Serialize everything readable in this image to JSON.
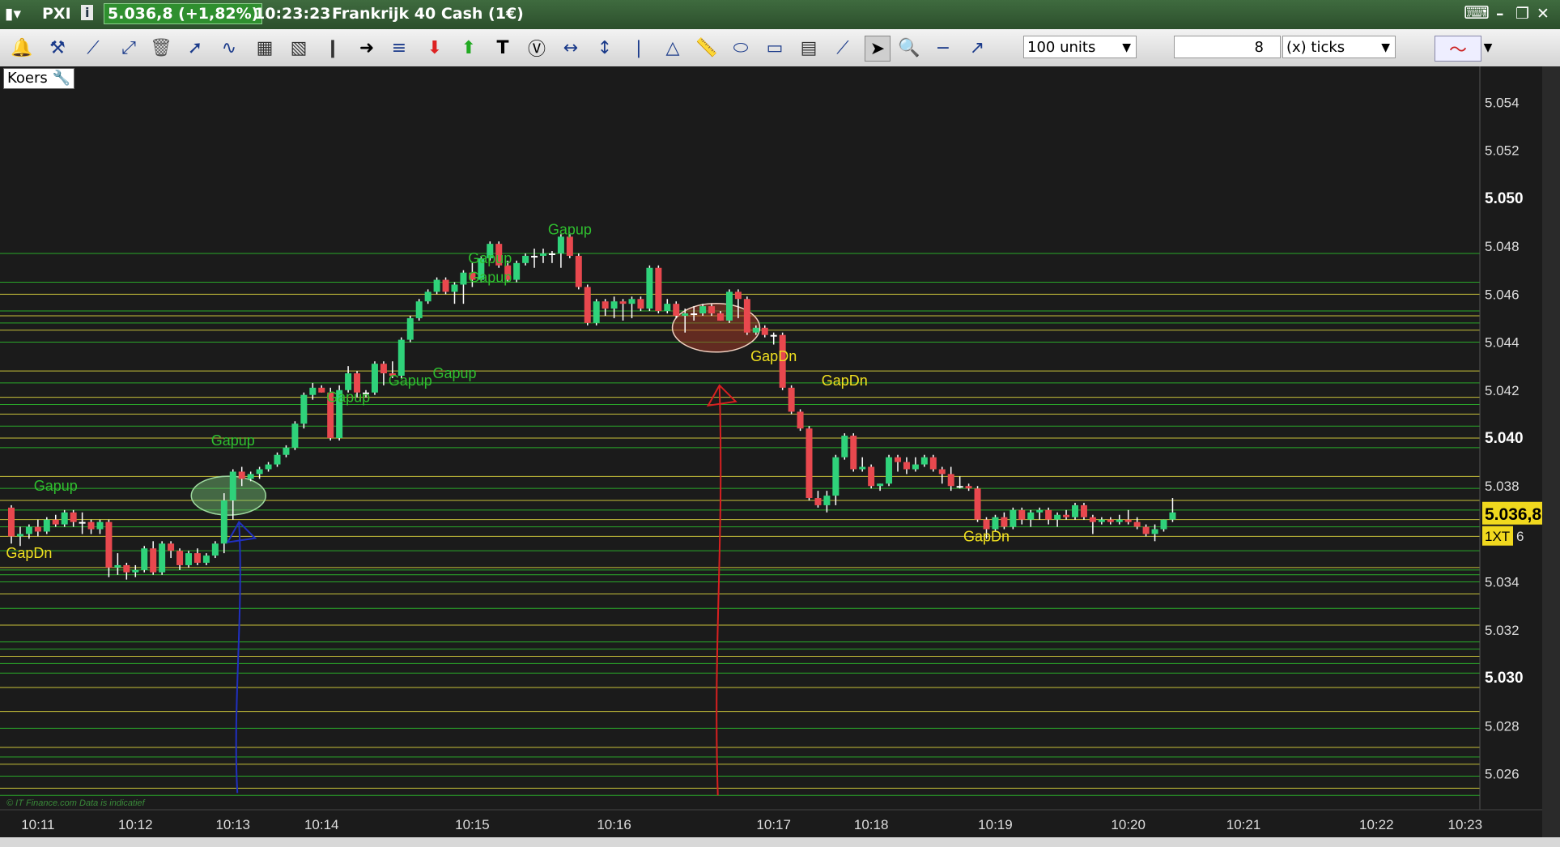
{
  "title": {
    "symbol": "PXI",
    "price_badge": "5.036,8 (+1,82%)",
    "time": "10:23:23",
    "instrument": "Frankrijk 40 Cash (1€)"
  },
  "toolbar": {
    "units": "100 units",
    "ticks_value": "8",
    "ticks_unit": "(x) ticks"
  },
  "panel_label": "Koers",
  "copyright": "© IT Finance.com  Data is indicatief",
  "colors": {
    "up": "#2fd27a",
    "down": "#e8484e",
    "bg": "#1b1b1b",
    "green_line": "#2aa82a",
    "yellow_line": "#c8c23a"
  },
  "chart_data": {
    "type": "candlestick",
    "y_range": [
      5.0245,
      5.0555
    ],
    "y_ticks": [
      5.054,
      5.052,
      5.05,
      5.048,
      5.046,
      5.044,
      5.042,
      5.04,
      5.038,
      5.036,
      5.034,
      5.032,
      5.03,
      5.028,
      5.026
    ],
    "y_tick_labels": [
      "5.054",
      "5.052",
      "5.050",
      "5.048",
      "5.046",
      "5.044",
      "5.042",
      "5.040",
      "5.038",
      "",
      "5.034",
      "5.032",
      "5.030",
      "5.028",
      "5.026"
    ],
    "y_bold": [
      "5.050",
      "5.040",
      "5.030"
    ],
    "x_ticks": [
      "10:11",
      "10:12",
      "10:13",
      "10:14",
      "10:15",
      "10:16",
      "10:17",
      "10:18",
      "10:19",
      "10:20",
      "10:21",
      "10:22",
      "10:23"
    ],
    "x_tick_index": [
      3,
      14,
      25,
      35,
      52,
      68,
      86,
      97,
      111,
      126,
      139,
      154,
      164
    ],
    "last_price": "5.036,8",
    "last_price_value": 5.0368,
    "cursor_tag": "1XT",
    "cursor_tag_suffix": "6",
    "candles": [
      [
        5.0371,
        5.0372,
        5.0356,
        5.0359
      ],
      [
        5.0359,
        5.0363,
        5.0355,
        5.036
      ],
      [
        5.036,
        5.0364,
        5.0358,
        5.0363
      ],
      [
        5.0363,
        5.0366,
        5.0359,
        5.0361
      ],
      [
        5.0361,
        5.0367,
        5.036,
        5.0366
      ],
      [
        5.0366,
        5.0368,
        5.0363,
        5.0364
      ],
      [
        5.0364,
        5.037,
        5.0363,
        5.0369
      ],
      [
        5.0369,
        5.037,
        5.0363,
        5.0365
      ],
      [
        5.0365,
        5.0369,
        5.036,
        5.0365
      ],
      [
        5.0365,
        5.0366,
        5.036,
        5.0362
      ],
      [
        5.0362,
        5.0366,
        5.036,
        5.0365
      ],
      [
        5.0365,
        5.0366,
        5.0342,
        5.0346
      ],
      [
        5.0346,
        5.0352,
        5.0343,
        5.0347
      ],
      [
        5.0347,
        5.0348,
        5.0341,
        5.0344
      ],
      [
        5.0344,
        5.0347,
        5.0342,
        5.0345
      ],
      [
        5.0345,
        5.0355,
        5.0344,
        5.0354
      ],
      [
        5.0354,
        5.0357,
        5.0343,
        5.0344
      ],
      [
        5.0344,
        5.0357,
        5.0343,
        5.0356
      ],
      [
        5.0356,
        5.0357,
        5.035,
        5.0353
      ],
      [
        5.0353,
        5.0354,
        5.0345,
        5.0347
      ],
      [
        5.0347,
        5.0353,
        5.0346,
        5.0352
      ],
      [
        5.0352,
        5.0354,
        5.0347,
        5.0348
      ],
      [
        5.0348,
        5.0352,
        5.0347,
        5.0351
      ],
      [
        5.0351,
        5.0357,
        5.035,
        5.0356
      ],
      [
        5.0356,
        5.0377,
        5.0352,
        5.0374
      ],
      [
        5.0374,
        5.0387,
        5.0366,
        5.0386
      ],
      [
        5.0386,
        5.0388,
        5.038,
        5.0383
      ],
      [
        5.0383,
        5.0386,
        5.0382,
        5.0385
      ],
      [
        5.0385,
        5.0388,
        5.0383,
        5.0387
      ],
      [
        5.0387,
        5.039,
        5.0386,
        5.0389
      ],
      [
        5.0389,
        5.0394,
        5.0388,
        5.0393
      ],
      [
        5.0393,
        5.0397,
        5.0392,
        5.0396
      ],
      [
        5.0396,
        5.0407,
        5.0395,
        5.0406
      ],
      [
        5.0406,
        5.0419,
        5.0404,
        5.0418
      ],
      [
        5.0418,
        5.0423,
        5.0416,
        5.0421
      ],
      [
        5.0421,
        5.0422,
        5.0419,
        5.0419
      ],
      [
        5.0419,
        5.0421,
        5.0399,
        5.04
      ],
      [
        5.04,
        5.0422,
        5.0399,
        5.042
      ],
      [
        5.042,
        5.043,
        5.0419,
        5.0427
      ],
      [
        5.0427,
        5.0428,
        5.0417,
        5.0419
      ],
      [
        5.0419,
        5.042,
        5.0417,
        5.0419
      ],
      [
        5.0419,
        5.0432,
        5.0418,
        5.0431
      ],
      [
        5.0431,
        5.0432,
        5.0422,
        5.0427
      ],
      [
        5.0427,
        5.0432,
        5.0425,
        5.0426
      ],
      [
        5.0426,
        5.0442,
        5.0425,
        5.0441
      ],
      [
        5.0441,
        5.0451,
        5.044,
        5.045
      ],
      [
        5.045,
        5.0458,
        5.0449,
        5.0457
      ],
      [
        5.0457,
        5.0462,
        5.0456,
        5.0461
      ],
      [
        5.0461,
        5.0467,
        5.046,
        5.0466
      ],
      [
        5.0466,
        5.0467,
        5.046,
        5.0461
      ],
      [
        5.0461,
        5.0465,
        5.0456,
        5.0464
      ],
      [
        5.0464,
        5.047,
        5.0456,
        5.0469
      ],
      [
        5.0469,
        5.0473,
        5.0463,
        5.0466
      ],
      [
        5.0466,
        5.0476,
        5.0465,
        5.0475
      ],
      [
        5.0475,
        5.0482,
        5.0474,
        5.0481
      ],
      [
        5.0481,
        5.0482,
        5.0471,
        5.0472
      ],
      [
        5.0472,
        5.0474,
        5.0465,
        5.0466
      ],
      [
        5.0466,
        5.0474,
        5.0465,
        5.0473
      ],
      [
        5.0473,
        5.0477,
        5.0472,
        5.0476
      ],
      [
        5.0476,
        5.0479,
        5.0471,
        5.0476
      ],
      [
        5.0476,
        5.0479,
        5.0473,
        5.0477
      ],
      [
        5.0477,
        5.0478,
        5.0473,
        5.0477
      ],
      [
        5.0477,
        5.0485,
        5.0471,
        5.0484
      ],
      [
        5.0484,
        5.0485,
        5.0475,
        5.0476
      ],
      [
        5.0476,
        5.0477,
        5.0462,
        5.0463
      ],
      [
        5.0463,
        5.0464,
        5.0447,
        5.0448
      ],
      [
        5.0448,
        5.0458,
        5.0447,
        5.0457
      ],
      [
        5.0457,
        5.0458,
        5.0451,
        5.0454
      ],
      [
        5.0454,
        5.0459,
        5.045,
        5.0457
      ],
      [
        5.0457,
        5.0458,
        5.0449,
        5.0456
      ],
      [
        5.0456,
        5.0459,
        5.045,
        5.0458
      ],
      [
        5.0458,
        5.0459,
        5.0453,
        5.0454
      ],
      [
        5.0454,
        5.0472,
        5.0453,
        5.0471
      ],
      [
        5.0471,
        5.0472,
        5.0452,
        5.0453
      ],
      [
        5.0453,
        5.0458,
        5.0452,
        5.0456
      ],
      [
        5.0456,
        5.0457,
        5.045,
        5.0451
      ],
      [
        5.0451,
        5.0454,
        5.0444,
        5.0452
      ],
      [
        5.0452,
        5.0455,
        5.0449,
        5.0452
      ],
      [
        5.0452,
        5.0456,
        5.0451,
        5.0455
      ],
      [
        5.0455,
        5.0456,
        5.0451,
        5.0452
      ],
      [
        5.0452,
        5.0453,
        5.0449,
        5.0449
      ],
      [
        5.0449,
        5.0462,
        5.0448,
        5.0461
      ],
      [
        5.0461,
        5.0462,
        5.045,
        5.0458
      ],
      [
        5.0458,
        5.0459,
        5.0443,
        5.0444
      ],
      [
        5.0444,
        5.0447,
        5.0443,
        5.0446
      ],
      [
        5.0446,
        5.0447,
        5.0442,
        5.0443
      ],
      [
        5.0443,
        5.0444,
        5.0439,
        5.0443
      ],
      [
        5.0443,
        5.0444,
        5.042,
        5.0421
      ],
      [
        5.0421,
        5.0422,
        5.041,
        5.0411
      ],
      [
        5.0411,
        5.0412,
        5.0403,
        5.0404
      ],
      [
        5.0404,
        5.0405,
        5.0374,
        5.0375
      ],
      [
        5.0375,
        5.0378,
        5.0371,
        5.0372
      ],
      [
        5.0372,
        5.0378,
        5.0369,
        5.0376
      ],
      [
        5.0376,
        5.0393,
        5.0372,
        5.0392
      ],
      [
        5.0392,
        5.0402,
        5.0391,
        5.0401
      ],
      [
        5.0401,
        5.0402,
        5.0386,
        5.0387
      ],
      [
        5.0387,
        5.0392,
        5.0386,
        5.0388
      ],
      [
        5.0388,
        5.0389,
        5.0379,
        5.038
      ],
      [
        5.038,
        5.0381,
        5.0378,
        5.0381
      ],
      [
        5.0381,
        5.0393,
        5.038,
        5.0392
      ],
      [
        5.0392,
        5.0393,
        5.0386,
        5.039
      ],
      [
        5.039,
        5.0392,
        5.0385,
        5.0387
      ],
      [
        5.0387,
        5.0392,
        5.0386,
        5.0389
      ],
      [
        5.0389,
        5.0393,
        5.0388,
        5.0392
      ],
      [
        5.0392,
        5.0393,
        5.0386,
        5.0387
      ],
      [
        5.0387,
        5.0388,
        5.0381,
        5.0385
      ],
      [
        5.0385,
        5.0388,
        5.0378,
        5.038
      ],
      [
        5.038,
        5.0384,
        5.0379,
        5.038
      ],
      [
        5.038,
        5.0381,
        5.0378,
        5.0379
      ],
      [
        5.0379,
        5.038,
        5.0365,
        5.0366
      ],
      [
        5.0366,
        5.0367,
        5.0358,
        5.0362
      ],
      [
        5.0362,
        5.0368,
        5.0361,
        5.0367
      ],
      [
        5.0367,
        5.0369,
        5.0362,
        5.0363
      ],
      [
        5.0363,
        5.0371,
        5.0362,
        5.037
      ],
      [
        5.037,
        5.0371,
        5.0364,
        5.0366
      ],
      [
        5.0366,
        5.037,
        5.0363,
        5.0369
      ],
      [
        5.0369,
        5.0371,
        5.0366,
        5.037
      ],
      [
        5.037,
        5.0371,
        5.0364,
        5.0366
      ],
      [
        5.0366,
        5.0369,
        5.0363,
        5.0368
      ],
      [
        5.0368,
        5.037,
        5.0366,
        5.0367
      ],
      [
        5.0367,
        5.0373,
        5.0366,
        5.0372
      ],
      [
        5.0372,
        5.0373,
        5.0366,
        5.0367
      ],
      [
        5.0367,
        5.0368,
        5.036,
        5.0365
      ],
      [
        5.0365,
        5.0367,
        5.0364,
        5.0366
      ],
      [
        5.0366,
        5.0367,
        5.0364,
        5.0365
      ],
      [
        5.0365,
        5.0368,
        5.0364,
        5.0366
      ],
      [
        5.0366,
        5.037,
        5.0364,
        5.0365
      ],
      [
        5.0365,
        5.0367,
        5.0362,
        5.0363
      ],
      [
        5.0363,
        5.0364,
        5.0359,
        5.036
      ],
      [
        5.036,
        5.0364,
        5.0357,
        5.0362
      ],
      [
        5.0362,
        5.0366,
        5.0361,
        5.0366
      ],
      [
        5.0366,
        5.0375,
        5.0365,
        5.0369
      ]
    ],
    "annotations": [
      {
        "text": "Gapup",
        "type": "up",
        "i": 5,
        "y": 5.0378
      },
      {
        "text": "GapDn",
        "type": "dn",
        "i": 2,
        "y": 5.035
      },
      {
        "text": "Gapup",
        "type": "up",
        "i": 25,
        "y": 5.0397
      },
      {
        "text": "Gapup",
        "type": "up",
        "i": 38,
        "y": 5.0415
      },
      {
        "text": "Gapup",
        "type": "up",
        "i": 45,
        "y": 5.0422
      },
      {
        "text": "Gapup",
        "type": "up",
        "i": 50,
        "y": 5.0425
      },
      {
        "text": "Gapup",
        "type": "up",
        "i": 54,
        "y": 5.0465
      },
      {
        "text": "Gapup",
        "type": "up",
        "i": 54,
        "y": 5.0473
      },
      {
        "text": "Gapup",
        "type": "up",
        "i": 63,
        "y": 5.0485
      },
      {
        "text": "GapDn",
        "type": "dn",
        "i": 86,
        "y": 5.0432
      },
      {
        "text": "GapDn",
        "type": "dn",
        "i": 94,
        "y": 5.0422
      },
      {
        "text": "GapDn",
        "type": "dn",
        "i": 110,
        "y": 5.0357
      }
    ],
    "h_lines": [
      {
        "y": 5.0477,
        "c": "g"
      },
      {
        "y": 5.0465,
        "c": "g"
      },
      {
        "y": 5.046,
        "c": "y"
      },
      {
        "y": 5.0453,
        "c": "g"
      },
      {
        "y": 5.0451,
        "c": "y"
      },
      {
        "y": 5.0448,
        "c": "g"
      },
      {
        "y": 5.0445,
        "c": "y"
      },
      {
        "y": 5.044,
        "c": "g"
      },
      {
        "y": 5.0428,
        "c": "y"
      },
      {
        "y": 5.0423,
        "c": "g"
      },
      {
        "y": 5.0417,
        "c": "y"
      },
      {
        "y": 5.0414,
        "c": "g"
      },
      {
        "y": 5.041,
        "c": "y"
      },
      {
        "y": 5.0405,
        "c": "g"
      },
      {
        "y": 5.04,
        "c": "y"
      },
      {
        "y": 5.0396,
        "c": "g"
      },
      {
        "y": 5.0384,
        "c": "y"
      },
      {
        "y": 5.0379,
        "c": "g"
      },
      {
        "y": 5.0374,
        "c": "y"
      },
      {
        "y": 5.037,
        "c": "g"
      },
      {
        "y": 5.0366,
        "c": "y"
      },
      {
        "y": 5.0363,
        "c": "g"
      },
      {
        "y": 5.0359,
        "c": "y"
      },
      {
        "y": 5.0353,
        "c": "g"
      },
      {
        "y": 5.0346,
        "c": "y"
      },
      {
        "y": 5.0345,
        "c": "g"
      },
      {
        "y": 5.0343,
        "c": "g"
      },
      {
        "y": 5.034,
        "c": "g"
      },
      {
        "y": 5.0335,
        "c": "y"
      },
      {
        "y": 5.0329,
        "c": "g"
      },
      {
        "y": 5.0322,
        "c": "y"
      },
      {
        "y": 5.0315,
        "c": "g"
      },
      {
        "y": 5.0312,
        "c": "g"
      },
      {
        "y": 5.0309,
        "c": "y"
      },
      {
        "y": 5.0306,
        "c": "g"
      },
      {
        "y": 5.0302,
        "c": "g"
      },
      {
        "y": 5.0296,
        "c": "y"
      },
      {
        "y": 5.0286,
        "c": "y"
      },
      {
        "y": 5.0279,
        "c": "g"
      },
      {
        "y": 5.0271,
        "c": "y"
      },
      {
        "y": 5.0267,
        "c": "g"
      },
      {
        "y": 5.0264,
        "c": "y"
      },
      {
        "y": 5.0259,
        "c": "g"
      },
      {
        "y": 5.0254,
        "c": "y"
      },
      {
        "y": 5.0251,
        "c": "g"
      }
    ],
    "highlights": [
      {
        "i": 24.5,
        "y": 5.0376,
        "color": "green"
      },
      {
        "i": 79.5,
        "y": 5.0446,
        "color": "red"
      }
    ],
    "arrows": [
      {
        "i": 25.5,
        "y_from": 5.0252,
        "y_to": 5.0365,
        "color": "blue"
      },
      {
        "i": 79.7,
        "y_from": 5.0251,
        "y_to": 5.0422,
        "color": "red"
      }
    ]
  }
}
